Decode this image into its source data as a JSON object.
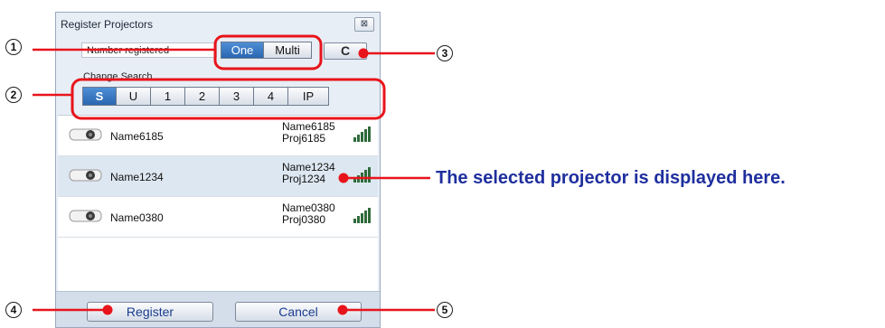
{
  "dialog": {
    "title": "Register Projectors",
    "close_label": "⊠"
  },
  "number_registered": {
    "label": "Number registered",
    "options": [
      "One",
      "Multi"
    ],
    "selected": "One"
  },
  "refresh": {
    "icon": "refresh-icon",
    "glyph": "C"
  },
  "change_search": {
    "label": "Change Search",
    "options": [
      "S",
      "U",
      "1",
      "2",
      "3",
      "4",
      "IP"
    ],
    "selected": "S"
  },
  "projectors": [
    {
      "name": "Name6185",
      "sub1": "Name6185",
      "sub2": "Proj6185",
      "selected": false
    },
    {
      "name": "Name1234",
      "sub1": "Name1234",
      "sub2": "Proj1234",
      "selected": true
    },
    {
      "name": "Name0380",
      "sub1": "Name0380",
      "sub2": "Proj0380",
      "selected": false
    }
  ],
  "footer": {
    "register_label": "Register",
    "cancel_label": "Cancel"
  },
  "callouts": {
    "n1": "1",
    "n2": "2",
    "n3": "3",
    "n4": "4",
    "n5": "5",
    "selected_text": "The selected projector is displayed here."
  },
  "colors": {
    "highlight": "#e8141b",
    "selected_blue": "#2a66b0",
    "callout_text": "#1f2f9e"
  }
}
